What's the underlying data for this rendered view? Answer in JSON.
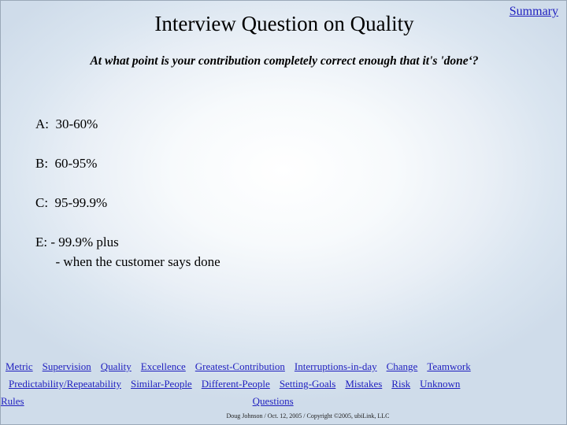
{
  "slide": {
    "title": "Interview Question on Quality",
    "summary_link": "Summary",
    "subtitle": "At what point is your contribution completely correct enough that it's 'done‘?",
    "answers": [
      "A:  30-60%",
      "B:  60-95%",
      "C:  95-99.9%",
      "E: - 99.9% plus\n      - when the customer says done"
    ],
    "footer": "Doug Johnson / Oct. 12, 2005  / Copyright ©2005, ubiLink, LLC"
  },
  "navigation": {
    "row1": [
      "Metric",
      "Supervision",
      "Quality",
      "Excellence",
      "Greatest-Contribution",
      "Interruptions-in-day",
      "Change",
      "Teamwork"
    ],
    "row2": [
      "Predictability/Repeatability",
      "Similar-People",
      "Different-People",
      "Setting-Goals",
      "Mistakes",
      "Risk",
      "Unknown"
    ],
    "row3": [
      "Rules",
      "Questions"
    ]
  },
  "colors": {
    "link": "#1f1fbf",
    "text": "#000000",
    "background_center": "#ffffff",
    "background_edge": "#cfdcea"
  }
}
